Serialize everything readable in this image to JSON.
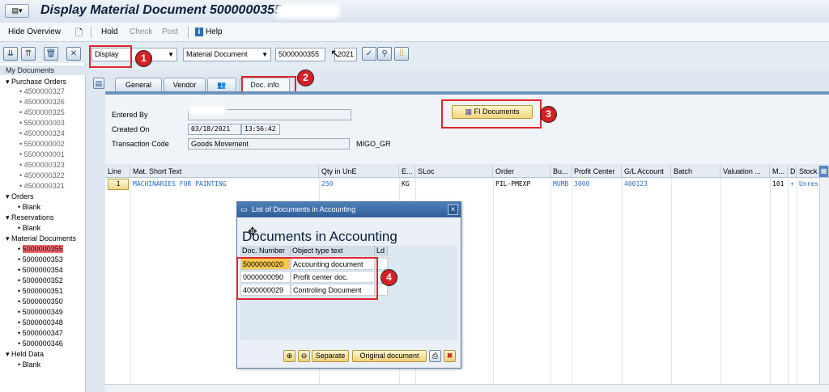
{
  "window": {
    "title": "Display Material Document 5000000355"
  },
  "menu": {
    "hide_overview": "Hide Overview",
    "hold": "Hold",
    "check": "Check",
    "post": "Post",
    "help": "Help"
  },
  "toolbar": {
    "mode": "Display",
    "doc_type": "Material Document",
    "doc_number": "5000000355",
    "year": "2021"
  },
  "sidebar": {
    "title": "My Documents",
    "groups": [
      {
        "label": "Purchase Orders",
        "items": [
          "4500000327",
          "4500000326",
          "4500000325",
          "5500000003",
          "4500000324",
          "5500000002",
          "5500000001",
          "4500000323",
          "4500000322",
          "4500000321"
        ]
      },
      {
        "label": "Orders",
        "items": [
          "Blank"
        ]
      },
      {
        "label": "Reservations",
        "items": [
          "Blank"
        ]
      },
      {
        "label": "Material Documents",
        "items": [
          "5000000355",
          "5000000353",
          "5000000354",
          "5000000352",
          "5000000351",
          "5000000350",
          "5000000349",
          "5000000348",
          "5000000347",
          "5000000346"
        ]
      },
      {
        "label": "Held Data",
        "items": [
          "Blank"
        ]
      }
    ]
  },
  "tabs": [
    "General",
    "Vendor",
    "",
    "Doc. info"
  ],
  "docinfo": {
    "entered_by_label": "Entered By",
    "entered_by": "",
    "created_on_label": "Created On",
    "created_date": "03/18/2021",
    "created_time": "13:56:42",
    "tcode_label": "Transaction Code",
    "tcode_text": "Goods Movement",
    "tcode": "MIGO_GR",
    "fi_button": "FI Documents"
  },
  "table": {
    "headers": [
      "Line",
      "Mat. Short Text",
      "Qty in UnE",
      "E...",
      "SLoc",
      "Order",
      "Bu...",
      "Profit Center",
      "G/L Account",
      "Batch",
      "Valuation ...",
      "M...",
      "D",
      "Stock"
    ],
    "rows": [
      [
        "1",
        "MACHINARIES FOR PAINTING",
        "250",
        "KG",
        "",
        "PIL-PMEXP",
        "MUMB",
        "3000",
        "400123",
        "",
        "",
        "101",
        "+",
        "Unres"
      ]
    ]
  },
  "dialog": {
    "title": "List of Documents in Accounting",
    "heading": "Documents in Accounting",
    "col_docnum": "Doc. Number",
    "col_type": "Object type text",
    "col_ld": "Ld",
    "rows": [
      {
        "num": "5000000020",
        "text": "Accounting document"
      },
      {
        "num": "0000000090",
        "text": "Profit center doc."
      },
      {
        "num": "4000000029",
        "text": "Controling Document"
      }
    ],
    "btn_separate": "Separate",
    "btn_original": "Original document"
  },
  "callouts": [
    "1",
    "2",
    "3",
    "4"
  ],
  "colors": {
    "accent": "#2f5f99",
    "highlight": "#f36d6d",
    "callout": "#d32226"
  }
}
